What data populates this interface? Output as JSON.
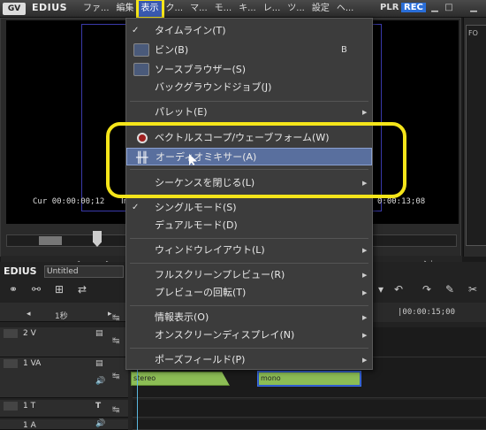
{
  "titlebar": {
    "app_icon": "GV",
    "app_name": "EDIUS",
    "menus": [
      "ファ...",
      "編集",
      "表示",
      "ク...",
      "マ...",
      "モ...",
      "キ...",
      "レ...",
      "ツ...",
      "設定",
      "ヘ..."
    ],
    "active_menu": "表示",
    "plr": "PLR",
    "rec": "REC"
  },
  "preview": {
    "cur_label": "Cur",
    "cur_timecode": "00:00:00;12",
    "in_label": "In",
    "right_timecode": "0:00:13;08"
  },
  "timeline": {
    "title": "EDIUS",
    "sequence_name": "Untitled",
    "scale": "1秒",
    "ruler_label": "|00:00:15;00",
    "tracks": [
      {
        "name": "2 V"
      },
      {
        "name": "1 VA"
      },
      {
        "name": "1 T"
      },
      {
        "name": "1 A"
      }
    ],
    "clips": [
      "stereo",
      "mono"
    ]
  },
  "right_panel": {
    "label": "FO"
  },
  "menu": {
    "items": [
      {
        "label": "タイムライン(T)",
        "check": "✓",
        "shortcut": "",
        "submenu": false
      },
      {
        "label": "ビン(B)",
        "check": "",
        "shortcut": "B",
        "submenu": false,
        "icon": "bin-icon"
      },
      {
        "label": "ソースブラウザー(S)",
        "check": "",
        "shortcut": "",
        "submenu": false,
        "icon": "source-browser-icon"
      },
      {
        "label": "バックグラウンドジョブ(J)",
        "check": "",
        "shortcut": "",
        "submenu": false
      },
      {
        "label": "パレット(E)",
        "check": "",
        "shortcut": "",
        "submenu": true
      },
      {
        "label": "ベクトルスコープ/ウェーブフォーム(W)",
        "check": "",
        "shortcut": "",
        "submenu": false,
        "icon": "vectorscope-icon"
      },
      {
        "label": "オーディオミキサー(A)",
        "check": "",
        "shortcut": "",
        "submenu": false,
        "icon": "audio-mixer-icon",
        "highlighted": true
      },
      {
        "label": "シーケンスを閉じる(L)",
        "check": "",
        "shortcut": "",
        "submenu": true
      },
      {
        "label": "シングルモード(S)",
        "check": "✓",
        "shortcut": "",
        "submenu": false
      },
      {
        "label": "デュアルモード(D)",
        "check": "",
        "shortcut": "",
        "submenu": false
      },
      {
        "label": "ウィンドウレイアウト(L)",
        "check": "",
        "shortcut": "",
        "submenu": true
      },
      {
        "label": "フルスクリーンプレビュー(R)",
        "check": "",
        "shortcut": "",
        "submenu": true
      },
      {
        "label": "プレビューの回転(T)",
        "check": "",
        "shortcut": "",
        "submenu": true
      },
      {
        "label": "情報表示(O)",
        "check": "",
        "shortcut": "",
        "submenu": true
      },
      {
        "label": "オンスクリーンディスプレイ(N)",
        "check": "",
        "shortcut": "",
        "submenu": true
      },
      {
        "label": "ポーズフィールド(P)",
        "check": "",
        "shortcut": "",
        "submenu": true
      }
    ]
  },
  "colors": {
    "highlight_annotation": "#f5e51a",
    "menu_highlight": "#596f9e",
    "clip_green": "#8cbd55",
    "rec_blue": "#2a6ed8"
  }
}
